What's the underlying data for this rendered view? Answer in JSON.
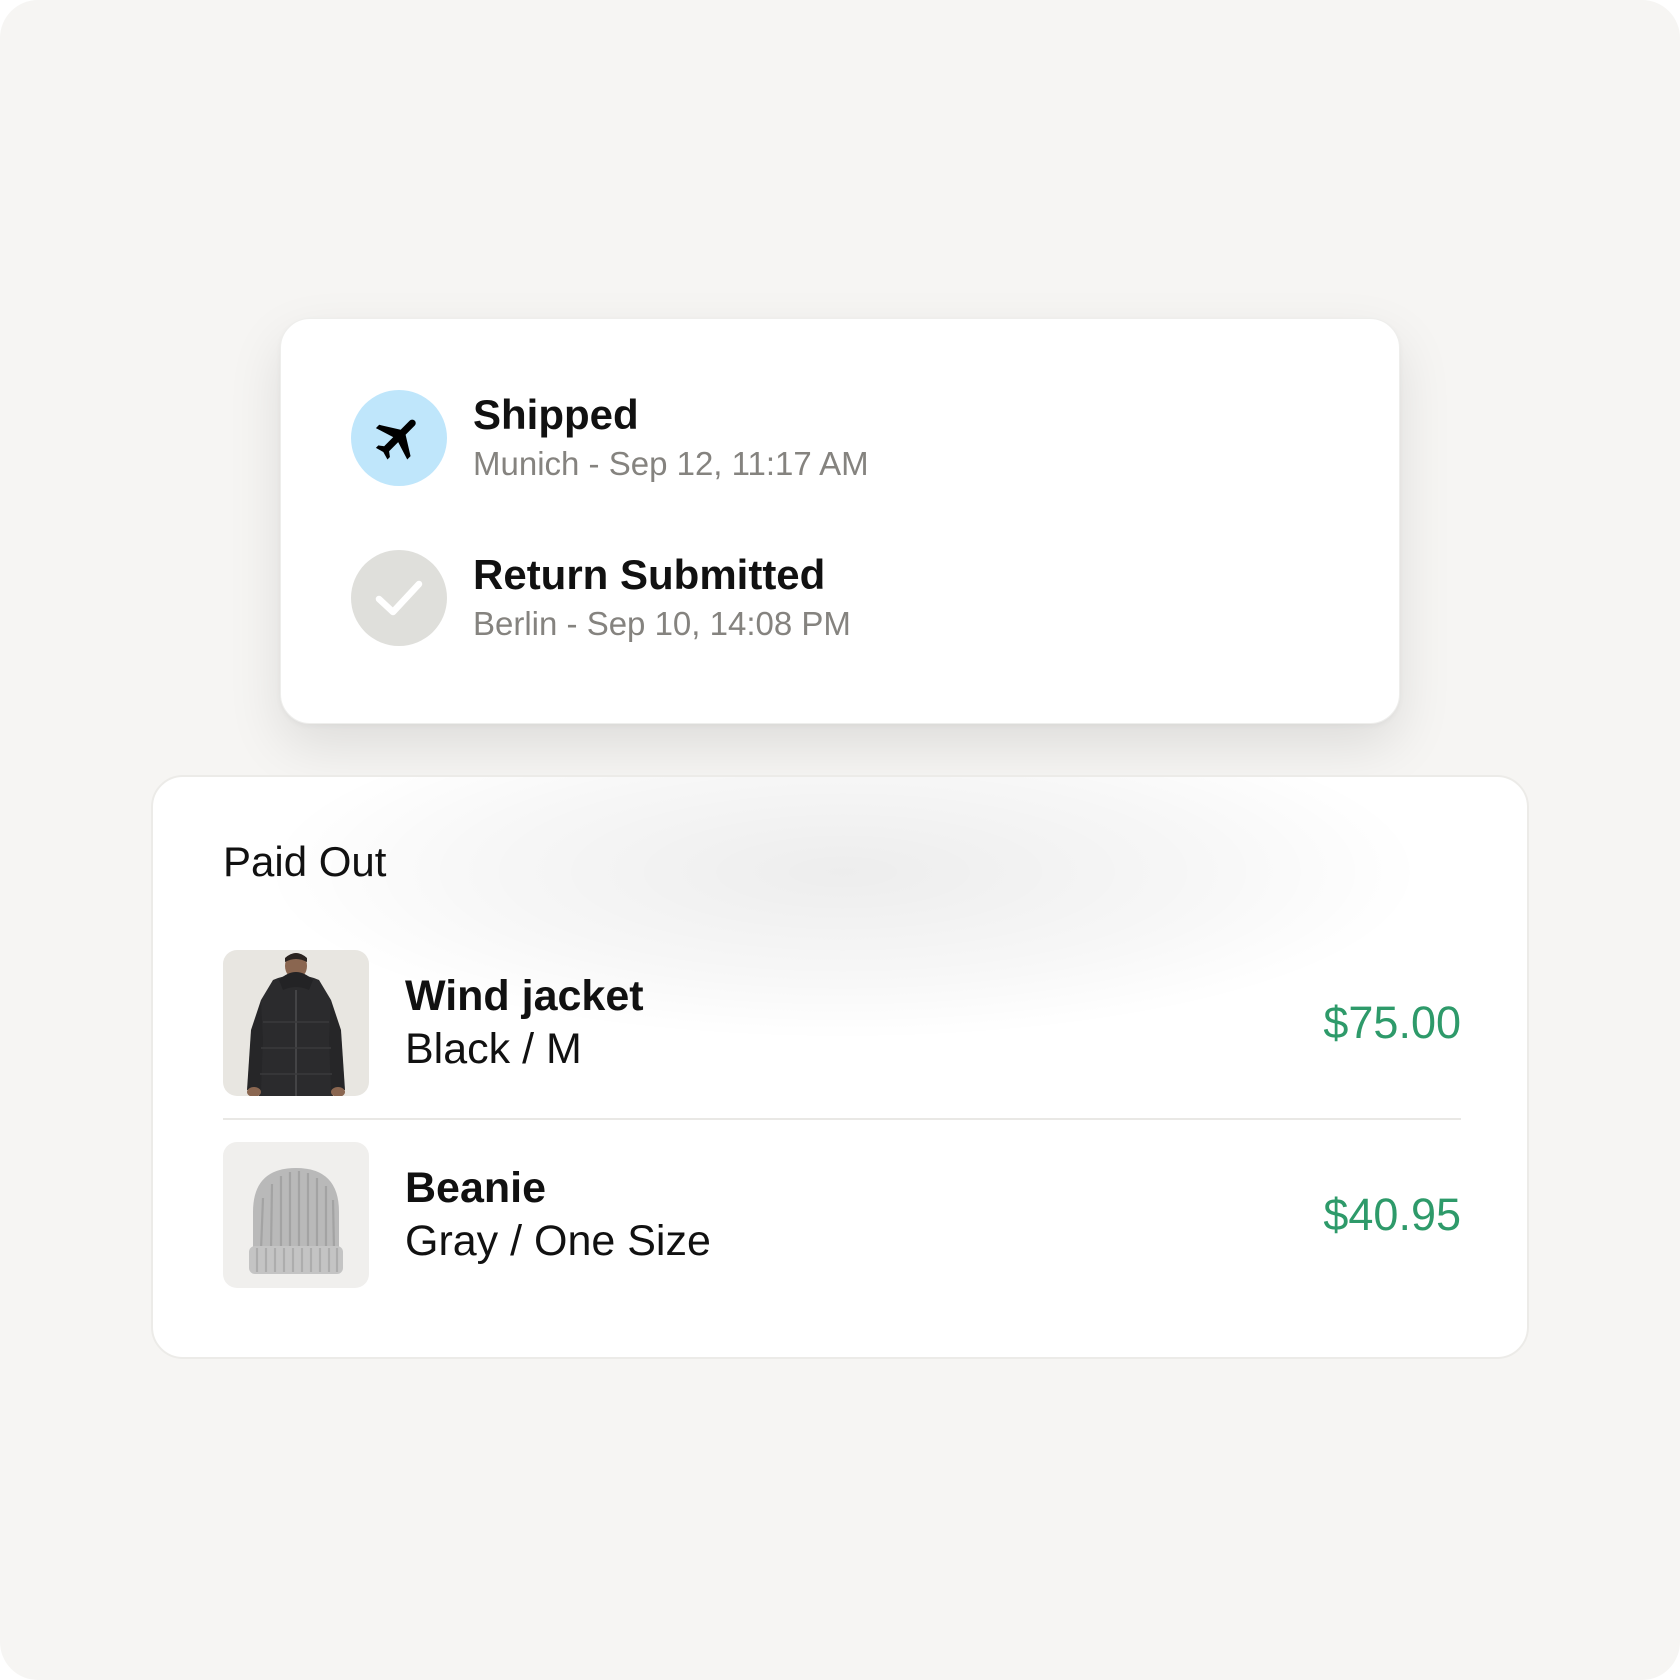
{
  "colors": {
    "background": "#f6f5f3",
    "card": "#ffffff",
    "shipped_icon_bg": "#bfe6fb",
    "submitted_icon_bg": "#dfdfdb",
    "subtext": "#85837f",
    "price": "#2e9a6a"
  },
  "tracking": {
    "events": [
      {
        "icon": "airplane-icon",
        "title": "Shipped",
        "detail": "Munich - Sep 12, 11:17 AM"
      },
      {
        "icon": "checkmark-icon",
        "title": "Return Submitted",
        "detail": "Berlin - Sep 10, 14:08 PM"
      }
    ]
  },
  "payout": {
    "title": "Paid Out",
    "items": [
      {
        "thumbnail": "wind-jacket-thumbnail",
        "name": "Wind jacket",
        "variant": "Black / M",
        "price": "$75.00"
      },
      {
        "thumbnail": "beanie-thumbnail",
        "name": "Beanie",
        "variant": "Gray / One Size",
        "price": "$40.95"
      }
    ]
  }
}
